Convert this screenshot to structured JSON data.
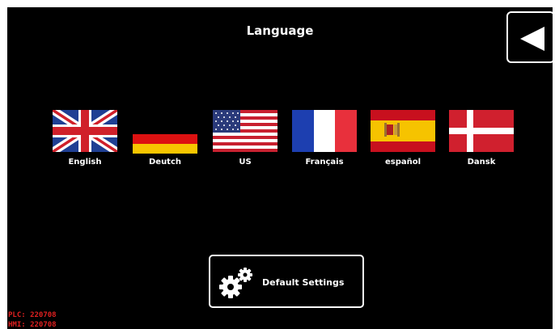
{
  "header": {
    "title": "Language"
  },
  "back_button": {
    "icon": "back-arrow-icon"
  },
  "languages": [
    {
      "label": "English",
      "flag": "uk-flag-icon"
    },
    {
      "label": "Deutch",
      "flag": "german-flag-icon"
    },
    {
      "label": "US",
      "flag": "us-flag-icon"
    },
    {
      "label": "Français",
      "flag": "french-flag-icon"
    },
    {
      "label": "español",
      "flag": "spanish-flag-icon"
    },
    {
      "label": "Dansk",
      "flag": "danish-flag-icon"
    }
  ],
  "default_settings": {
    "label": "Default Settings",
    "icon": "gears-icon"
  },
  "version_info": {
    "plc": "PLC: 220708",
    "hmi": "HMI: 220708"
  },
  "colors": {
    "background": "#000000",
    "text": "#ffffff",
    "version_text": "#e02020"
  }
}
